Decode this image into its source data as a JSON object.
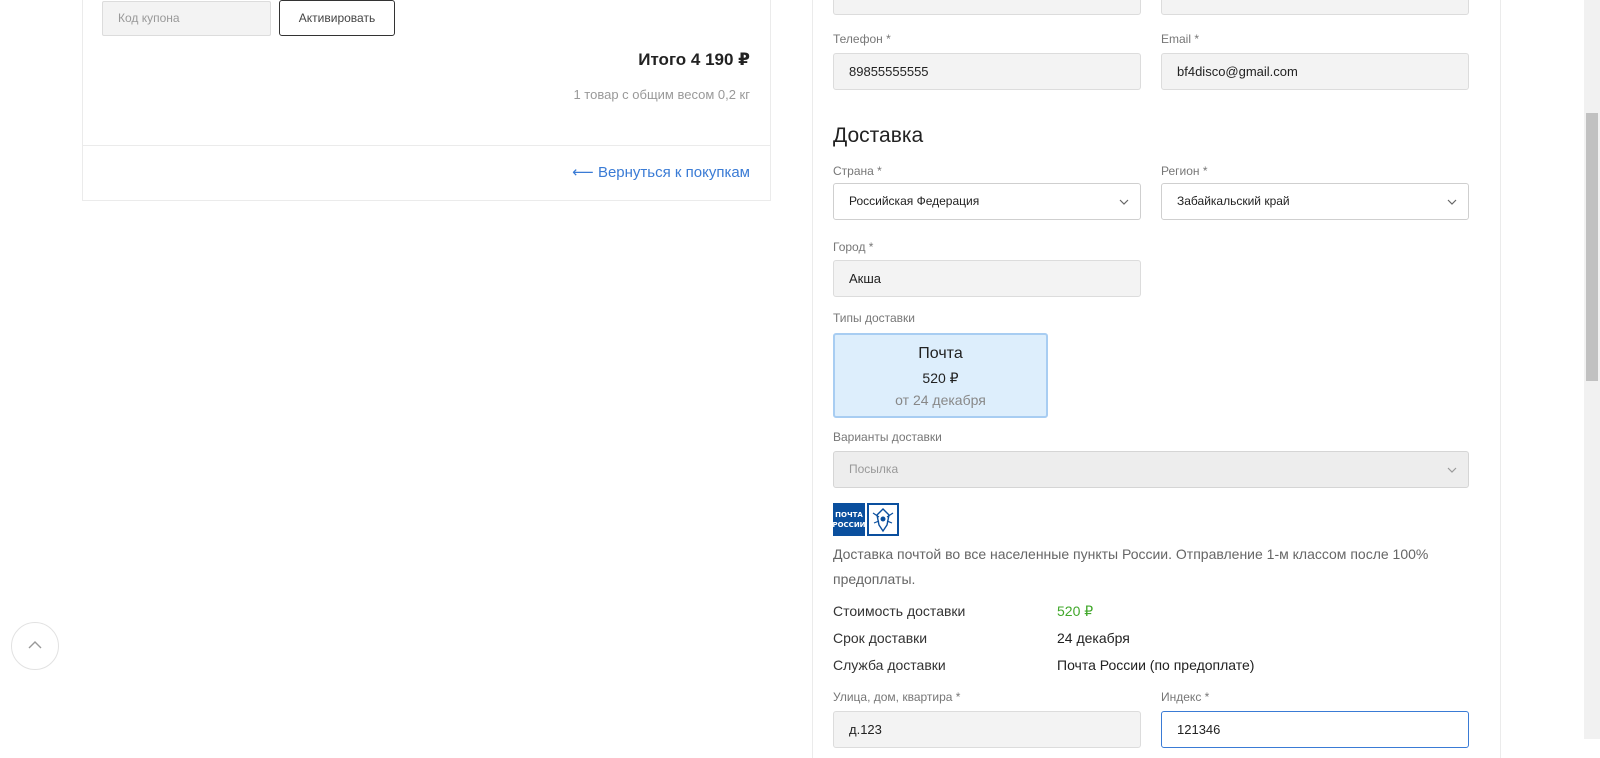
{
  "cart": {
    "coupon_placeholder": "Код купона",
    "coupon_button": "Активировать",
    "total": "Итого 4 190 ₽",
    "weight_note": "1 товар с общим весом 0,2 кг",
    "back_link": "⟵ Вернуться к покупкам"
  },
  "contact": {
    "phone_label": "Телефон *",
    "phone_value": "89855555555",
    "email_label": "Email *",
    "email_value": "bf4disco@gmail.com"
  },
  "delivery": {
    "title": "Доставка",
    "country_label": "Страна *",
    "country_value": "Российская Федерация",
    "region_label": "Регион *",
    "region_value": "Забайкальский край",
    "city_label": "Город *",
    "city_value": "Акша",
    "types_label": "Типы доставки",
    "type_card": {
      "name": "Почта",
      "price": "520 ₽",
      "date": "от 24 декабря"
    },
    "variants_label": "Варианты доставки",
    "variant_value": "Посылка",
    "logo_text_line1": "ПОЧТА",
    "logo_text_line2": "РОССИИ",
    "description": "Доставка почтой во все населенные пункты России. Отправление 1-м классом после 100% предоплаты.",
    "cost_label": "Стоимость доставки",
    "cost_value": "520 ₽",
    "term_label": "Срок доставки",
    "term_value": "24 декабря",
    "service_label": "Служба доставки",
    "service_value": "Почта России (по предоплате)",
    "street_label": "Улица, дом, квартира *",
    "street_value": "д.123",
    "index_label": "Индекс *",
    "index_value": "121346"
  },
  "colors": {
    "accent": "#3a7bd5",
    "card_bg": "#ddeefc",
    "price_green": "#41a82b"
  }
}
